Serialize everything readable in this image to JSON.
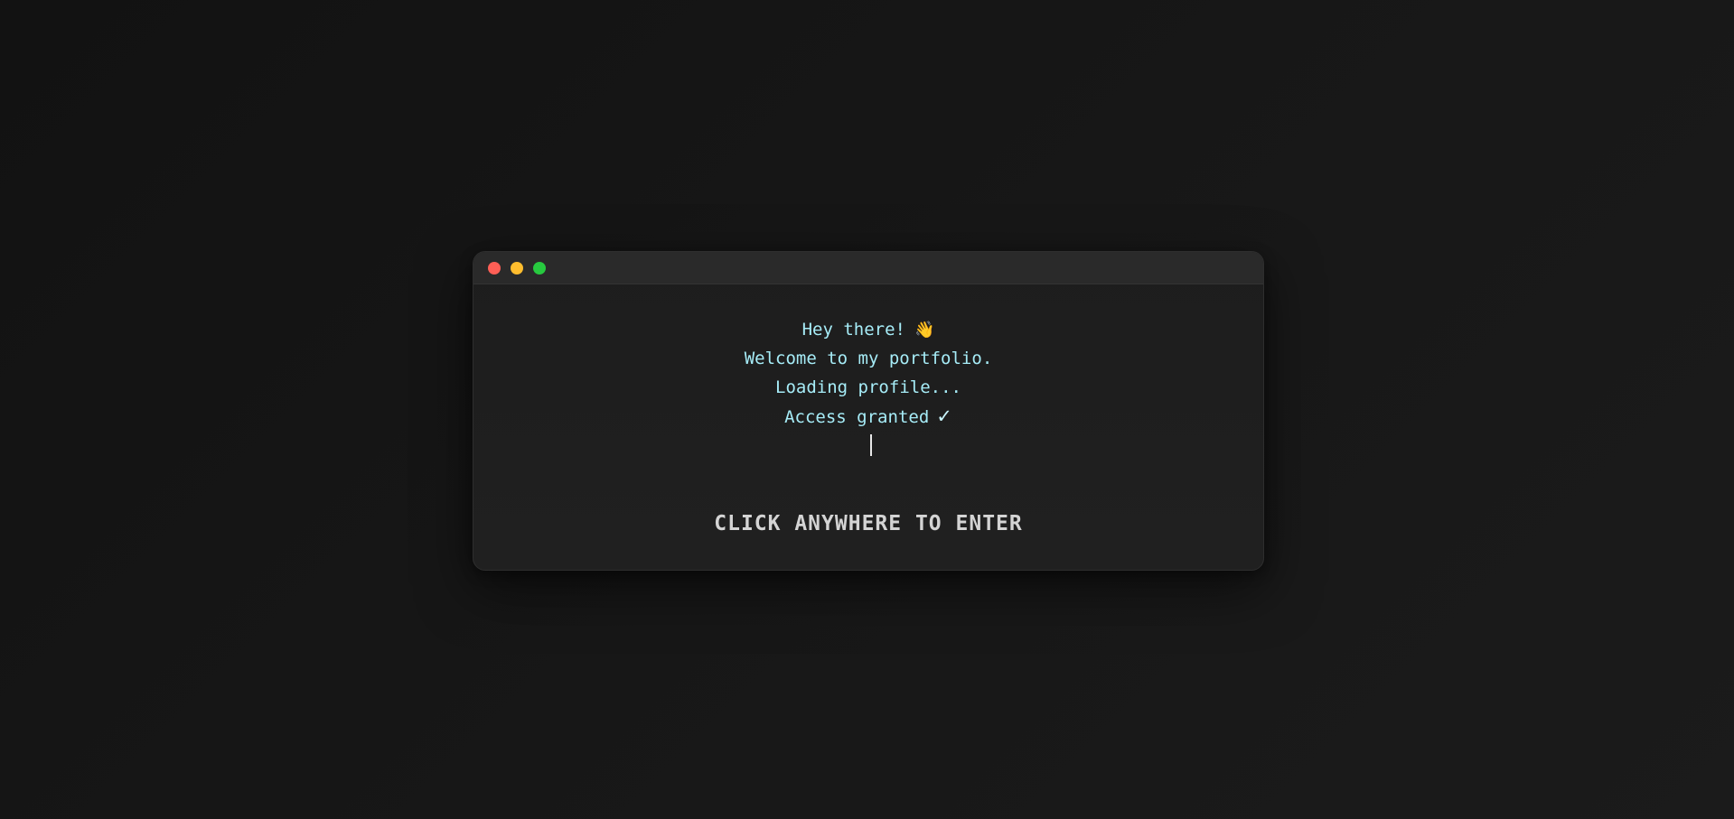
{
  "window": {
    "controls": {
      "close_color": "#ff5f56",
      "minimize_color": "#ffbd2e",
      "maximize_color": "#27c93f"
    }
  },
  "terminal": {
    "lines": [
      "Hey there!",
      "Welcome to my portfolio.",
      "Loading profile...",
      "Access granted"
    ],
    "wave_emoji": "👋",
    "check_mark": "✓",
    "text_color": "#a6ecf7"
  },
  "prompt": {
    "label": "CLICK ANYWHERE TO ENTER"
  },
  "icons": {
    "wave": "waving-hand-icon",
    "check": "check-mark-icon",
    "cursor": "text-cursor"
  }
}
